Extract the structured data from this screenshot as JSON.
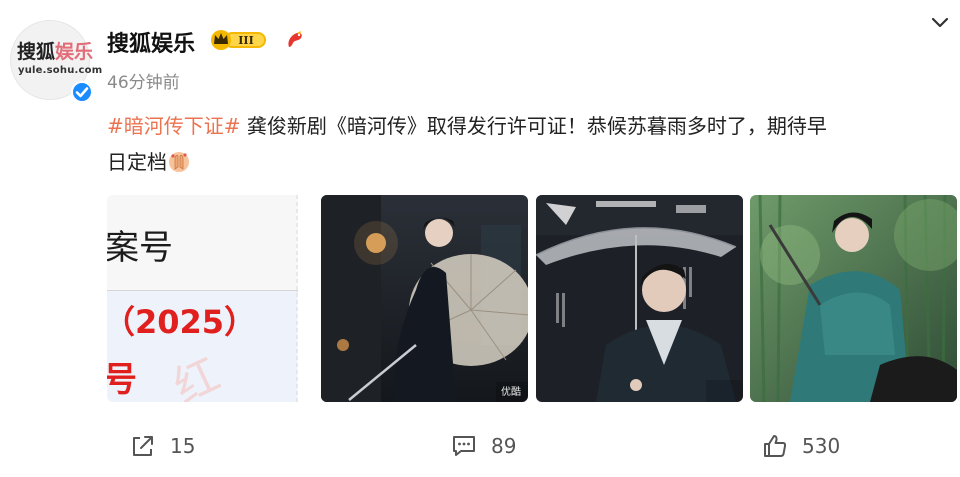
{
  "post": {
    "author": {
      "name": "搜狐娱乐",
      "avatar_text_dark": "搜狐",
      "avatar_text_pink": "娱乐",
      "avatar_url_text": "yule.sohu.com",
      "vip_level": "III",
      "verified": true
    },
    "time": "46分钟前",
    "hashtag": "#暗河传下证#",
    "text_line1": " 龚俊新剧《暗河传》取得发行许可证！恭候苏暮雨多时了，期待早",
    "text_line2": "日定档",
    "emoji_name": "pray-hands-emoji",
    "images": [
      {
        "name": "license-certificate",
        "text_top": "案号",
        "text_mid": "（2025）",
        "text_bottom": "号",
        "text_stamp": "红"
      },
      {
        "name": "actor-umbrella-night",
        "watermark": "优酷"
      },
      {
        "name": "actor-umbrella-poster"
      },
      {
        "name": "actor-forest-green"
      }
    ],
    "actions": {
      "repost_count": "15",
      "comment_count": "89",
      "like_count": "530"
    }
  },
  "icons": [
    "chevron-down-icon",
    "vip-crown-icon",
    "fan-badge-icon",
    "verified-icon",
    "repost-icon",
    "comment-icon",
    "like-icon"
  ],
  "colors": {
    "hashtag": "#eb7350",
    "verified": "#1a8cff",
    "vip_gold": "#f5b800",
    "text_secondary": "#8a8a8a"
  }
}
